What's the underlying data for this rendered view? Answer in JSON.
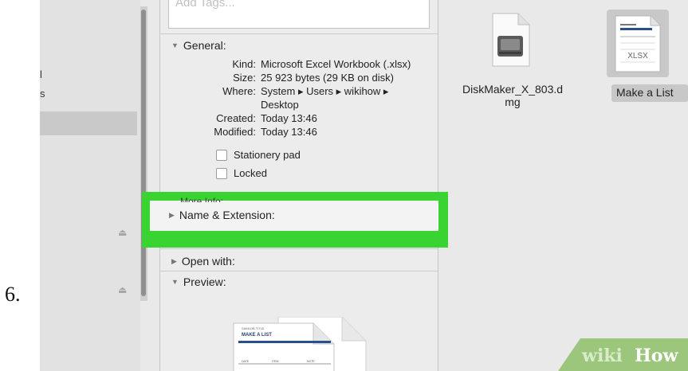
{
  "step": {
    "number": "6."
  },
  "tags": {
    "placeholder": "Add Tags..."
  },
  "general": {
    "header": "General:",
    "kind_label": "Kind:",
    "kind_value": "Microsoft Excel Workbook (.xlsx)",
    "size_label": "Size:",
    "size_value": "25 923 bytes (29 KB on disk)",
    "where_label": "Where:",
    "where_value_line1": "System ▸ Users ▸ wikihow ▸",
    "where_value_line2": "Desktop",
    "created_label": "Created:",
    "created_value": "Today 13:46",
    "modified_label": "Modified:",
    "modified_value": "Today 13:46",
    "stationery_label": "Stationery pad",
    "locked_label": "Locked"
  },
  "more_info": {
    "header": "More Info:"
  },
  "name_extension": {
    "header": "Name & Extension:"
  },
  "open_with": {
    "header": "Open with:"
  },
  "preview": {
    "header": "Preview:",
    "doc_title_small": "SAMLOB TITLE",
    "doc_title": "MAKE A LIST",
    "doc_col1": "DATE",
    "doc_col2": "ITEM",
    "doc_col3": "NOTE"
  },
  "desktop": {
    "file1_label_line1": "DiskMaker_X_803.d",
    "file1_label_line2": "mg",
    "file2_label": "Make a List",
    "file2_thumb_text": "XLSX"
  },
  "sidebar": {
    "char1": "l",
    "char2": "s"
  },
  "watermark": {
    "text_a": "wiki",
    "text_b": "How"
  },
  "colors": {
    "highlight": "#39d431",
    "watermark_green": "#8fc06a"
  }
}
